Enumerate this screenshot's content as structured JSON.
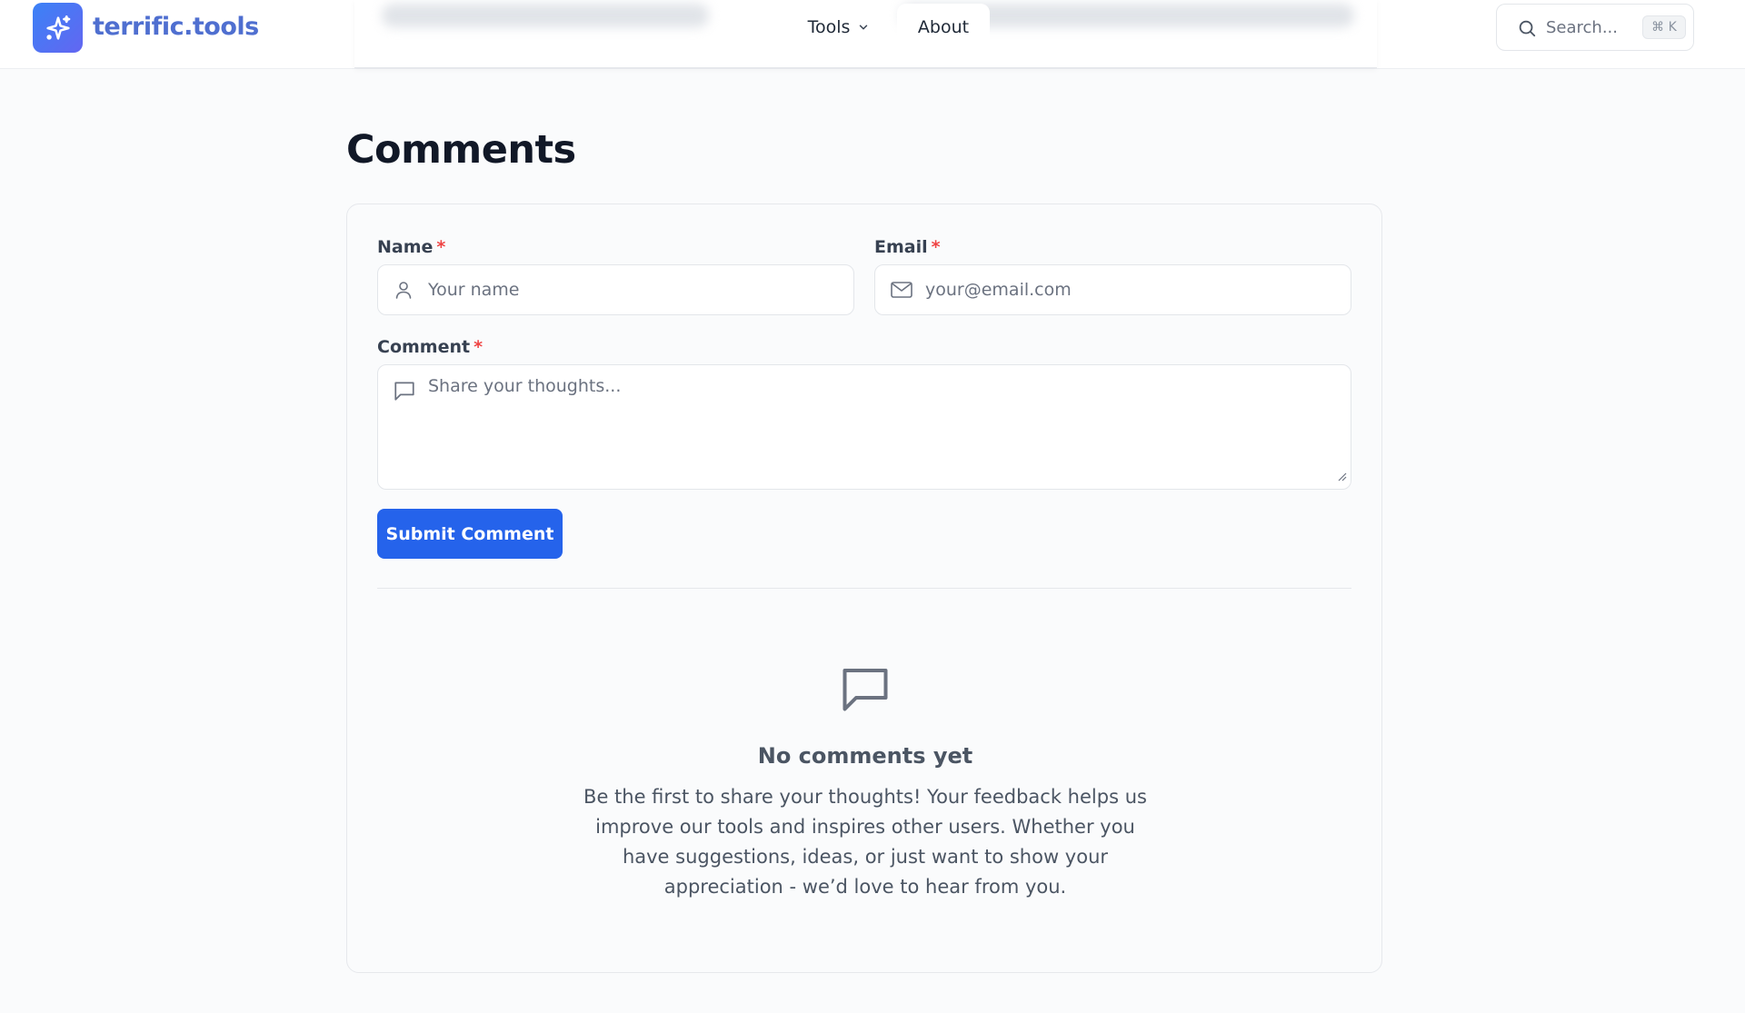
{
  "header": {
    "brand": "terrific.tools",
    "nav": {
      "tools_label": "Tools",
      "about_label": "About"
    },
    "search": {
      "placeholder": "Search...",
      "shortcut": "⌘ K"
    }
  },
  "main": {
    "title": "Comments",
    "form": {
      "name_label": "Name",
      "name_placeholder": "Your name",
      "email_label": "Email",
      "email_placeholder": "your@email.com",
      "comment_label": "Comment",
      "comment_placeholder": "Share your thoughts...",
      "required_marker": "*",
      "submit_label": "Submit Comment"
    },
    "empty_state": {
      "title": "No comments yet",
      "text": "Be the first to share your thoughts! Your feedback helps us improve our tools and inspires other users. Whether you have suggestions, ideas, or just want to show your appreciation - we’d love to hear from you."
    }
  },
  "colors": {
    "accent": "#2563eb",
    "brand_text": "#4f6fd0",
    "required": "#ef4444"
  },
  "icons": [
    "sparkle-icon",
    "chevron-down-icon",
    "search-icon",
    "user-icon",
    "mail-icon",
    "message-square-icon",
    "resize-handle-icon",
    "comment-bubble-icon"
  ]
}
